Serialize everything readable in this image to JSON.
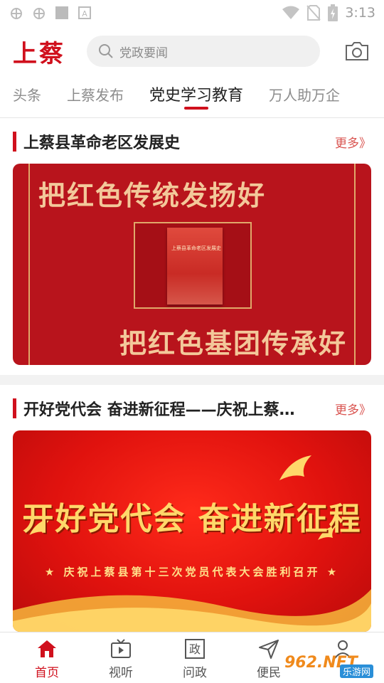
{
  "status_bar": {
    "icons": [
      "bug-icon",
      "bug-icon",
      "square-icon",
      "a-icon",
      "wifi-icon",
      "no-sim-icon",
      "battery-icon"
    ],
    "time": "3:13"
  },
  "header": {
    "logo": "上蔡",
    "search_placeholder": "党政要闻",
    "camera_icon": "camera-icon"
  },
  "tabs": [
    {
      "label": "头条",
      "active": false
    },
    {
      "label": "上蔡发布",
      "active": false
    },
    {
      "label": "党史学习教育",
      "active": true
    },
    {
      "label": "万人助万企",
      "active": false
    }
  ],
  "sections": [
    {
      "title": "上蔡县革命老区发展史",
      "more": "更多》",
      "banner": {
        "line1": "把红色传统发扬好",
        "line2": "把红色基团传承好",
        "book_title": "上蔡县革命老区发展史"
      }
    },
    {
      "title": "开好党代会 奋进新征程——庆祝上蔡…",
      "more": "更多》",
      "banner": {
        "title": "开好党代会 奋进新征程",
        "subtitle": "★ 庆祝上蔡县第十三次党员代表大会胜利召开 ★"
      }
    }
  ],
  "bottom_nav": [
    {
      "label": "首页",
      "icon": "home-icon",
      "active": true
    },
    {
      "label": "视听",
      "icon": "tv-icon",
      "active": false
    },
    {
      "label": "问政",
      "icon": "zheng-icon",
      "icon_text": "政",
      "active": false
    },
    {
      "label": "便民",
      "icon": "send-icon",
      "active": false
    },
    {
      "label": "",
      "icon": "user-icon",
      "active": false
    }
  ],
  "watermark": {
    "text": "962.NET",
    "sub": "乐游网"
  },
  "colors": {
    "brand": "#d0101d",
    "more": "#d9534f",
    "banner_gold": "#f3c89a"
  }
}
